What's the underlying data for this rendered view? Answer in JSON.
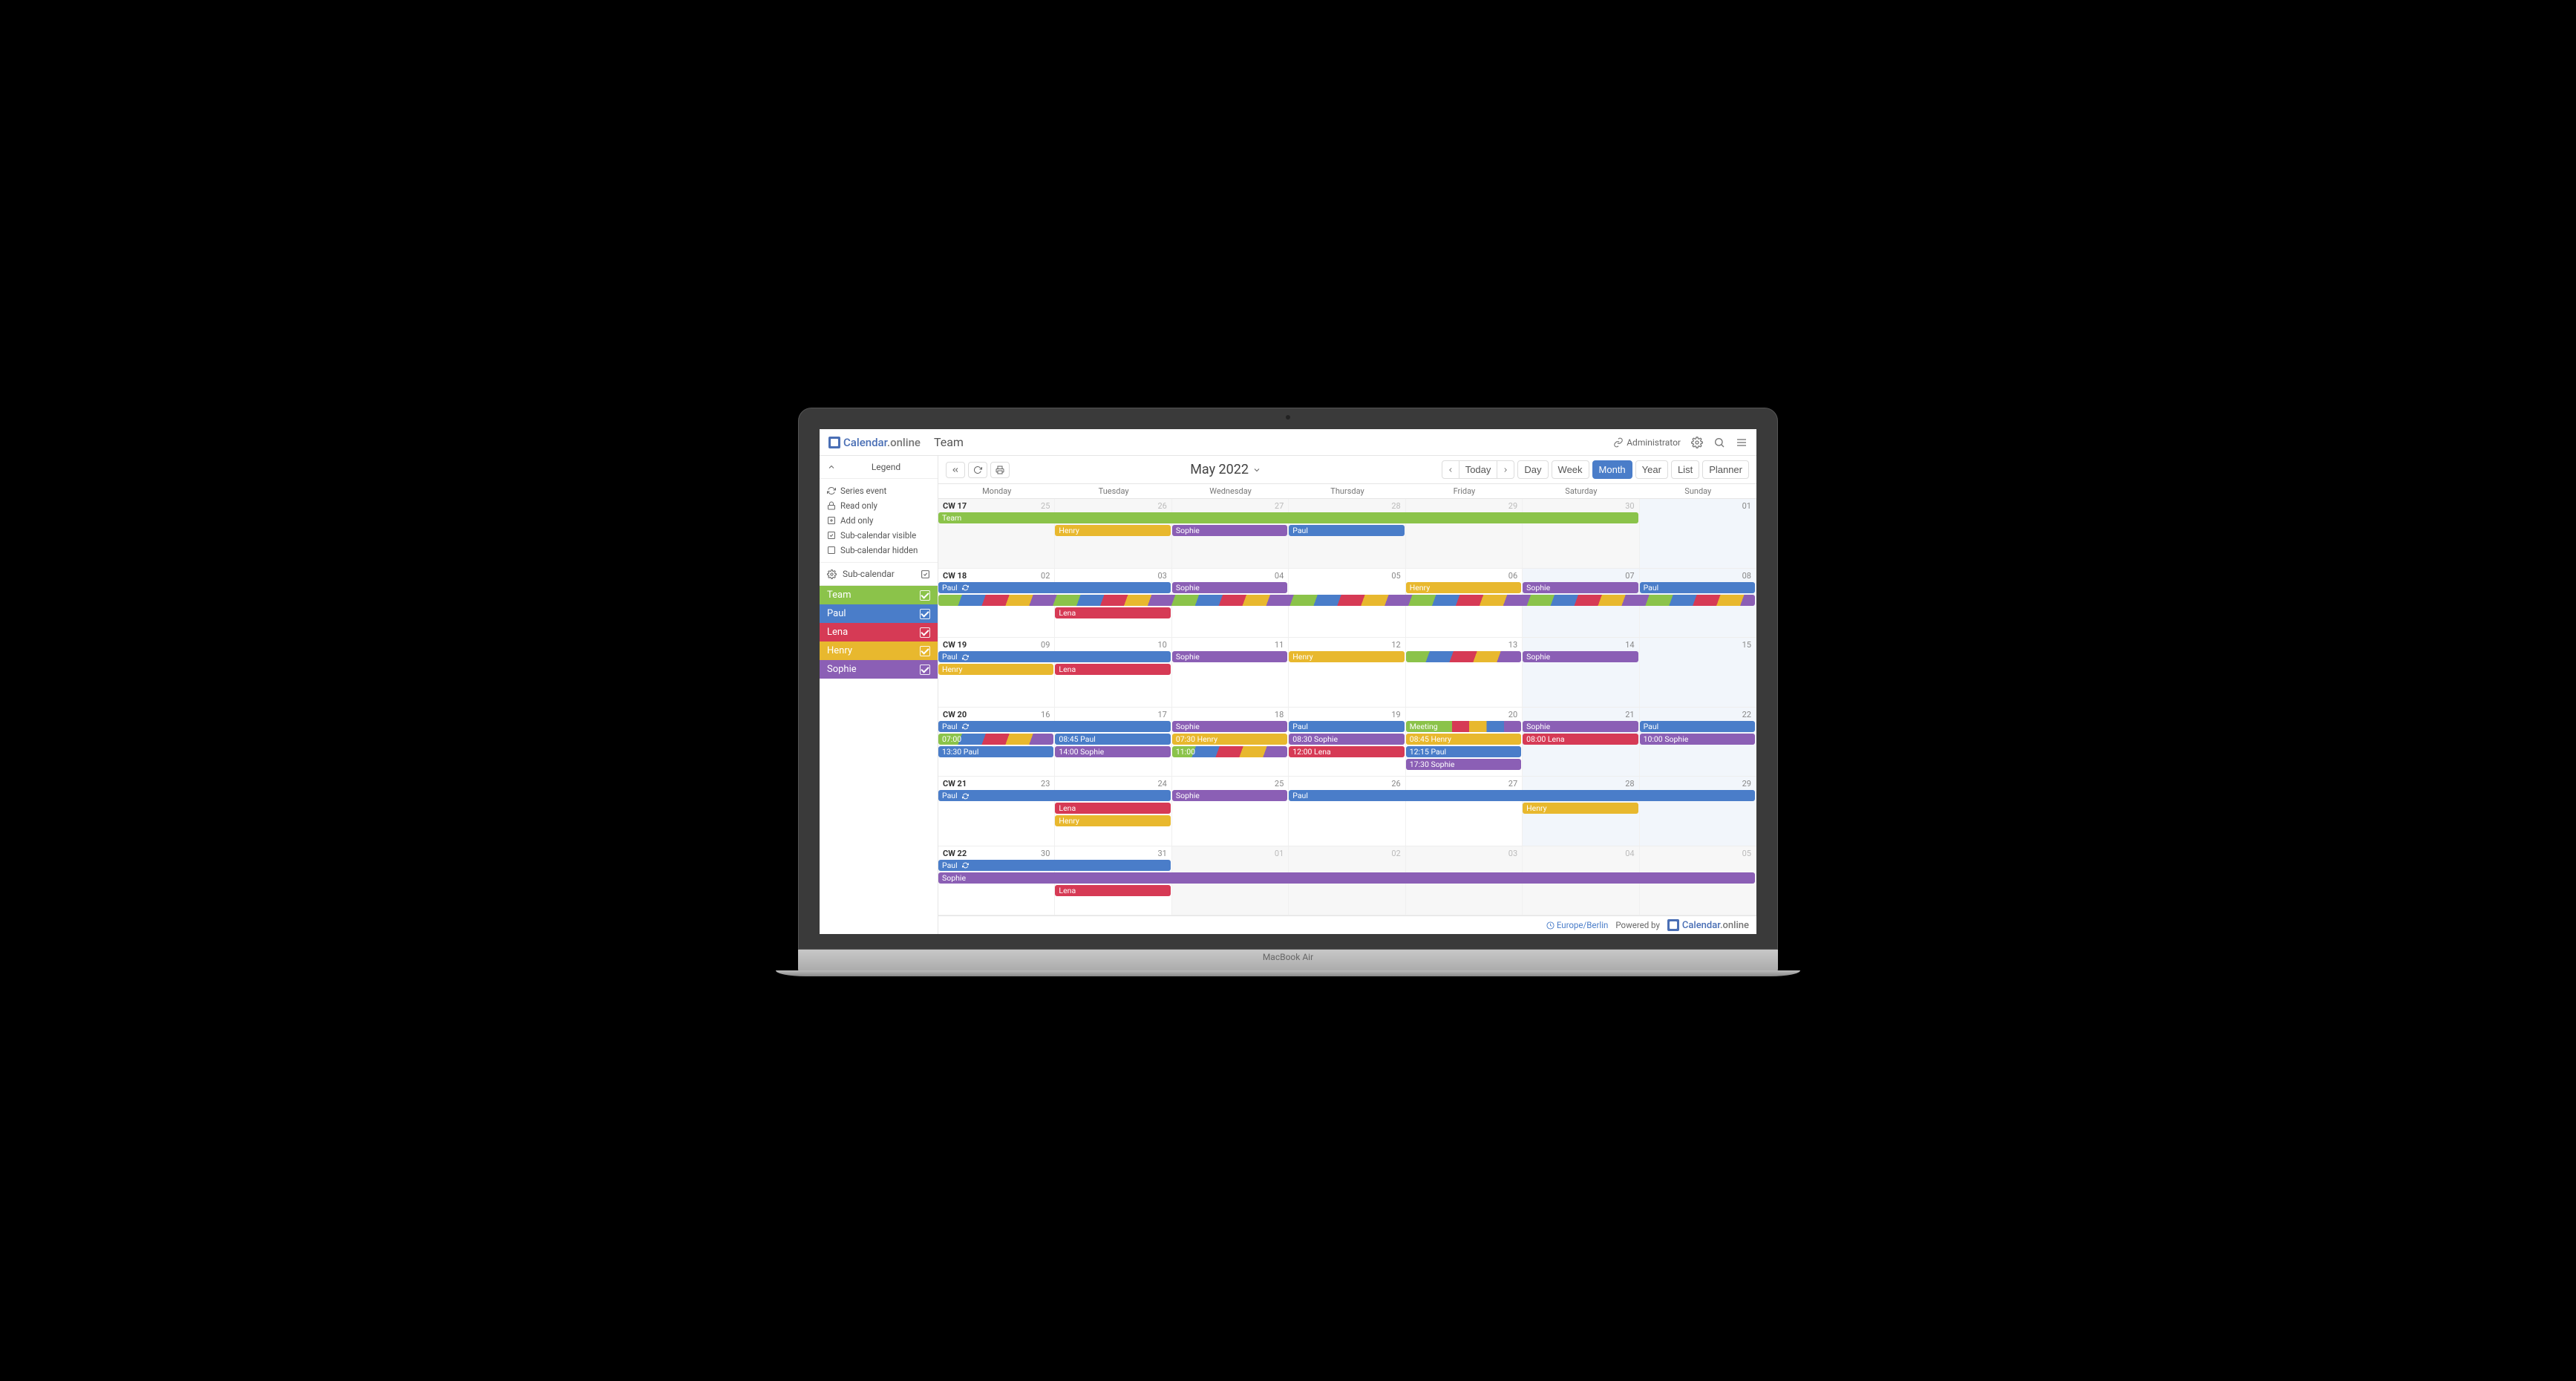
{
  "brand": {
    "name1": "Calendar",
    "name2": ".online"
  },
  "page_title": "Team",
  "header": {
    "admin_label": "Administrator"
  },
  "toolbar": {
    "date_label": "May 2022",
    "today": "Today",
    "views": [
      "Day",
      "Week",
      "Month",
      "Year",
      "List",
      "Planner"
    ],
    "active_view": "Month"
  },
  "sidebar": {
    "legend_title": "Legend",
    "legend_items": [
      {
        "icon": "refresh",
        "label": "Series event"
      },
      {
        "icon": "lock",
        "label": "Read only"
      },
      {
        "icon": "plus-box",
        "label": "Add only"
      },
      {
        "icon": "check-on",
        "label": "Sub-calendar visible"
      },
      {
        "icon": "check-off",
        "label": "Sub-calendar hidden"
      }
    ],
    "subcal_title": "Sub-calendar",
    "subcals": [
      {
        "name": "Team",
        "color": "#8bc34a"
      },
      {
        "name": "Paul",
        "color": "#4a7dc9"
      },
      {
        "name": "Lena",
        "color": "#d63a55"
      },
      {
        "name": "Henry",
        "color": "#e8b82e"
      },
      {
        "name": "Sophie",
        "color": "#8b5fb5"
      }
    ]
  },
  "colors": {
    "team": "#8bc34a",
    "paul": "#4a7dc9",
    "lena": "#d63a55",
    "henry": "#e8b82e",
    "sophie": "#8b5fb5"
  },
  "weekdays": [
    "Monday",
    "Tuesday",
    "Wednesday",
    "Thursday",
    "Friday",
    "Saturday",
    "Sunday"
  ],
  "weeks": [
    {
      "cw": "CW 17",
      "days": [
        {
          "num": "25",
          "other": true
        },
        {
          "num": "26",
          "other": true
        },
        {
          "num": "27",
          "other": true
        },
        {
          "num": "28",
          "other": true
        },
        {
          "num": "29",
          "other": true
        },
        {
          "num": "30",
          "other": true,
          "weekend": true
        },
        {
          "num": "01",
          "weekend": true
        }
      ],
      "events": [
        {
          "row": 0,
          "start": 0,
          "span": 6,
          "color": "team",
          "label": "Team"
        },
        {
          "row": 1,
          "start": 1,
          "span": 1,
          "color": "henry",
          "label": "Henry"
        },
        {
          "row": 1,
          "start": 2,
          "span": 1,
          "color": "sophie",
          "label": "Sophie"
        },
        {
          "row": 1,
          "start": 3,
          "span": 1,
          "color": "paul",
          "label": "Paul"
        }
      ]
    },
    {
      "cw": "CW 18",
      "days": [
        {
          "num": "02"
        },
        {
          "num": "03"
        },
        {
          "num": "04"
        },
        {
          "num": "05"
        },
        {
          "num": "06"
        },
        {
          "num": "07",
          "weekend": true
        },
        {
          "num": "08",
          "weekend": true
        }
      ],
      "events": [
        {
          "row": 0,
          "start": 0,
          "span": 2,
          "color": "paul",
          "label": "Paul",
          "refresh": true
        },
        {
          "row": 0,
          "start": 2,
          "span": 1,
          "color": "sophie",
          "label": "Sophie"
        },
        {
          "row": 0,
          "start": 4,
          "span": 1,
          "color": "henry",
          "label": "Henry"
        },
        {
          "row": 0,
          "start": 5,
          "span": 1,
          "color": "sophie",
          "label": "Sophie"
        },
        {
          "row": 0,
          "start": 6,
          "span": 1,
          "color": "paul",
          "label": "Paul"
        },
        {
          "row": 1,
          "start": 0,
          "span": 7,
          "stripe": true,
          "label": ""
        },
        {
          "row": 2,
          "start": 1,
          "span": 1,
          "color": "lena",
          "label": "Lena"
        }
      ]
    },
    {
      "cw": "CW 19",
      "days": [
        {
          "num": "09"
        },
        {
          "num": "10"
        },
        {
          "num": "11"
        },
        {
          "num": "12"
        },
        {
          "num": "13"
        },
        {
          "num": "14",
          "weekend": true
        },
        {
          "num": "15",
          "weekend": true
        }
      ],
      "events": [
        {
          "row": 0,
          "start": 0,
          "span": 2,
          "color": "paul",
          "label": "Paul",
          "refresh": true
        },
        {
          "row": 0,
          "start": 2,
          "span": 1,
          "color": "sophie",
          "label": "Sophie"
        },
        {
          "row": 0,
          "start": 3,
          "span": 1,
          "color": "henry",
          "label": "Henry"
        },
        {
          "row": 0,
          "start": 4,
          "span": 1,
          "stripe": true,
          "label": ""
        },
        {
          "row": 0,
          "start": 5,
          "span": 1,
          "color": "sophie",
          "label": "Sophie"
        },
        {
          "row": 1,
          "start": 0,
          "span": 1,
          "color": "henry",
          "label": "Henry"
        },
        {
          "row": 1,
          "start": 1,
          "span": 1,
          "color": "lena",
          "label": "Lena"
        }
      ]
    },
    {
      "cw": "CW 20",
      "days": [
        {
          "num": "16"
        },
        {
          "num": "17"
        },
        {
          "num": "18"
        },
        {
          "num": "19"
        },
        {
          "num": "20"
        },
        {
          "num": "21",
          "weekend": true
        },
        {
          "num": "22",
          "weekend": true
        }
      ],
      "events": [
        {
          "row": 0,
          "start": 0,
          "span": 2,
          "color": "paul",
          "label": "Paul",
          "refresh": true
        },
        {
          "row": 0,
          "start": 2,
          "span": 1,
          "color": "sophie",
          "label": "Sophie"
        },
        {
          "row": 0,
          "start": 3,
          "span": 1,
          "color": "paul",
          "label": "Paul"
        },
        {
          "row": 0,
          "start": 4,
          "span": 1,
          "color": "team",
          "label": "Meeting",
          "stripe_partial": true
        },
        {
          "row": 0,
          "start": 5,
          "span": 1,
          "color": "sophie",
          "label": "Sophie"
        },
        {
          "row": 0,
          "start": 6,
          "span": 1,
          "color": "paul",
          "label": "Paul"
        },
        {
          "row": 1,
          "start": 0,
          "span": 1,
          "stripe": true,
          "label": "07:00"
        },
        {
          "row": 1,
          "start": 1,
          "span": 1,
          "color": "paul",
          "label": "08:45 Paul"
        },
        {
          "row": 1,
          "start": 2,
          "span": 1,
          "color": "henry",
          "label": "07:30 Henry"
        },
        {
          "row": 1,
          "start": 3,
          "span": 1,
          "color": "sophie",
          "label": "08:30 Sophie"
        },
        {
          "row": 1,
          "start": 4,
          "span": 1,
          "color": "henry",
          "label": "08:45 Henry"
        },
        {
          "row": 1,
          "start": 5,
          "span": 1,
          "color": "lena",
          "label": "08:00 Lena"
        },
        {
          "row": 1,
          "start": 6,
          "span": 1,
          "color": "sophie",
          "label": "10:00 Sophie"
        },
        {
          "row": 2,
          "start": 0,
          "span": 1,
          "color": "paul",
          "label": "13:30 Paul"
        },
        {
          "row": 2,
          "start": 1,
          "span": 1,
          "color": "sophie",
          "label": "14:00 Sophie"
        },
        {
          "row": 2,
          "start": 2,
          "span": 1,
          "stripe": true,
          "label": "11:00"
        },
        {
          "row": 2,
          "start": 3,
          "span": 1,
          "color": "lena",
          "label": "12:00 Lena"
        },
        {
          "row": 2,
          "start": 4,
          "span": 1,
          "color": "paul",
          "label": "12:15 Paul"
        },
        {
          "row": 3,
          "start": 4,
          "span": 1,
          "color": "sophie",
          "label": "17:30 Sophie"
        }
      ]
    },
    {
      "cw": "CW 21",
      "days": [
        {
          "num": "23"
        },
        {
          "num": "24"
        },
        {
          "num": "25"
        },
        {
          "num": "26"
        },
        {
          "num": "27"
        },
        {
          "num": "28",
          "weekend": true
        },
        {
          "num": "29",
          "weekend": true
        }
      ],
      "events": [
        {
          "row": 0,
          "start": 0,
          "span": 2,
          "color": "paul",
          "label": "Paul",
          "refresh": true
        },
        {
          "row": 0,
          "start": 2,
          "span": 1,
          "color": "sophie",
          "label": "Sophie"
        },
        {
          "row": 0,
          "start": 3,
          "span": 4,
          "color": "paul",
          "label": "Paul"
        },
        {
          "row": 1,
          "start": 1,
          "span": 1,
          "color": "lena",
          "label": "Lena"
        },
        {
          "row": 1,
          "start": 5,
          "span": 1,
          "color": "henry",
          "label": "Henry"
        },
        {
          "row": 2,
          "start": 1,
          "span": 1,
          "color": "henry",
          "label": "Henry"
        }
      ]
    },
    {
      "cw": "CW 22",
      "days": [
        {
          "num": "30"
        },
        {
          "num": "31"
        },
        {
          "num": "01",
          "other": true
        },
        {
          "num": "02",
          "other": true
        },
        {
          "num": "03",
          "other": true
        },
        {
          "num": "04",
          "other": true,
          "weekend": true
        },
        {
          "num": "05",
          "other": true,
          "weekend": true
        }
      ],
      "events": [
        {
          "row": 0,
          "start": 0,
          "span": 2,
          "color": "paul",
          "label": "Paul",
          "refresh": true
        },
        {
          "row": 1,
          "start": 0,
          "span": 7,
          "color": "sophie",
          "label": "Sophie"
        },
        {
          "row": 2,
          "start": 1,
          "span": 1,
          "color": "lena",
          "label": "Lena"
        }
      ]
    }
  ],
  "footer": {
    "timezone": "Europe/Berlin",
    "powered": "Powered by"
  },
  "laptop_label": "MacBook Air"
}
